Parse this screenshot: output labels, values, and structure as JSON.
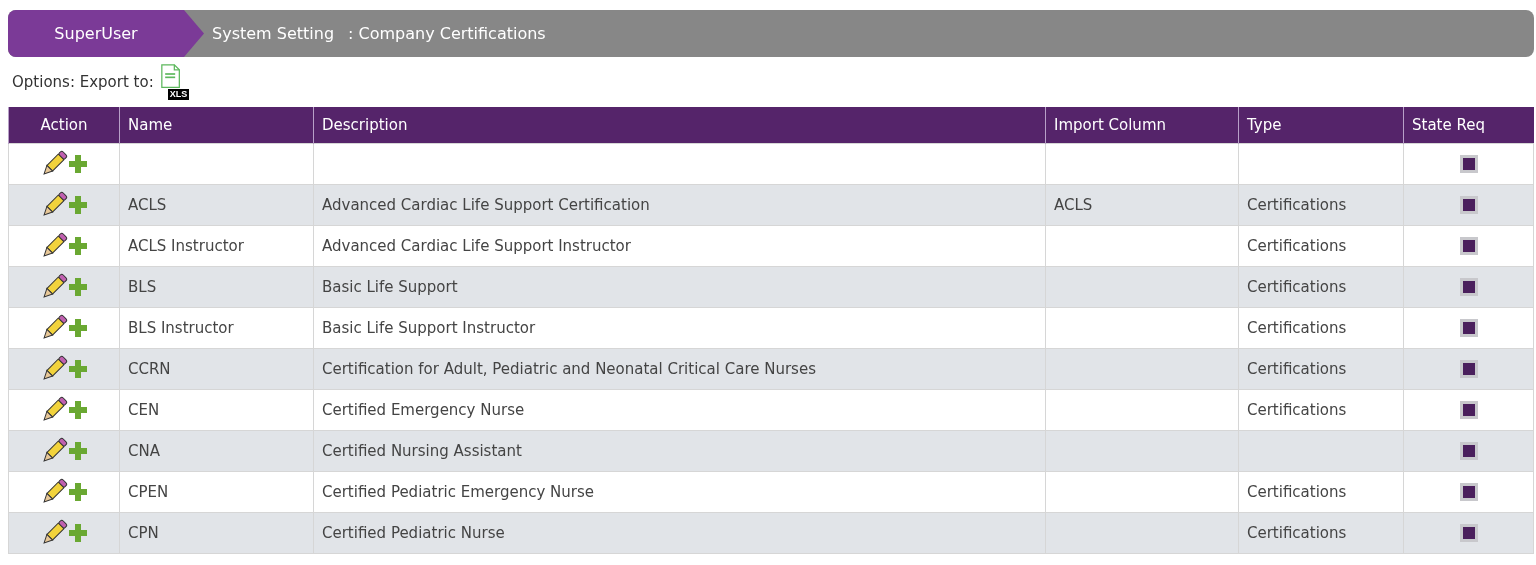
{
  "breadcrumb": {
    "root": "SuperUser",
    "section": "System Setting",
    "page": ": Company Certifications"
  },
  "options": {
    "label": "Options: Export to:",
    "export_icon_label": "XLS"
  },
  "table": {
    "columns": [
      "Action",
      "Name",
      "Description",
      "Import Column",
      "Type",
      "State Req"
    ],
    "rows": [
      {
        "name": "",
        "description": "",
        "import_column": "",
        "type": "",
        "state_req": true
      },
      {
        "name": "ACLS",
        "description": "Advanced Cardiac Life Support Certification",
        "import_column": "ACLS",
        "type": "Certifications",
        "state_req": true
      },
      {
        "name": "ACLS Instructor",
        "description": "Advanced Cardiac Life Support Instructor",
        "import_column": "",
        "type": "Certifications",
        "state_req": true
      },
      {
        "name": "BLS",
        "description": "Basic Life Support",
        "import_column": "",
        "type": "Certifications",
        "state_req": true
      },
      {
        "name": "BLS Instructor",
        "description": "Basic Life Support Instructor",
        "import_column": "",
        "type": "Certifications",
        "state_req": true
      },
      {
        "name": "CCRN",
        "description": "Certification for Adult, Pediatric and Neonatal Critical Care Nurses",
        "import_column": "",
        "type": "Certifications",
        "state_req": true
      },
      {
        "name": "CEN",
        "description": "Certified Emergency Nurse",
        "import_column": "",
        "type": "Certifications",
        "state_req": true
      },
      {
        "name": "CNA",
        "description": "Certified Nursing Assistant",
        "import_column": "",
        "type": "",
        "state_req": true
      },
      {
        "name": "CPEN",
        "description": "Certified Pediatric Emergency Nurse",
        "import_column": "",
        "type": "Certifications",
        "state_req": true
      },
      {
        "name": "CPN",
        "description": "Certified Pediatric Nurse",
        "import_column": "",
        "type": "Certifications",
        "state_req": true
      }
    ]
  }
}
